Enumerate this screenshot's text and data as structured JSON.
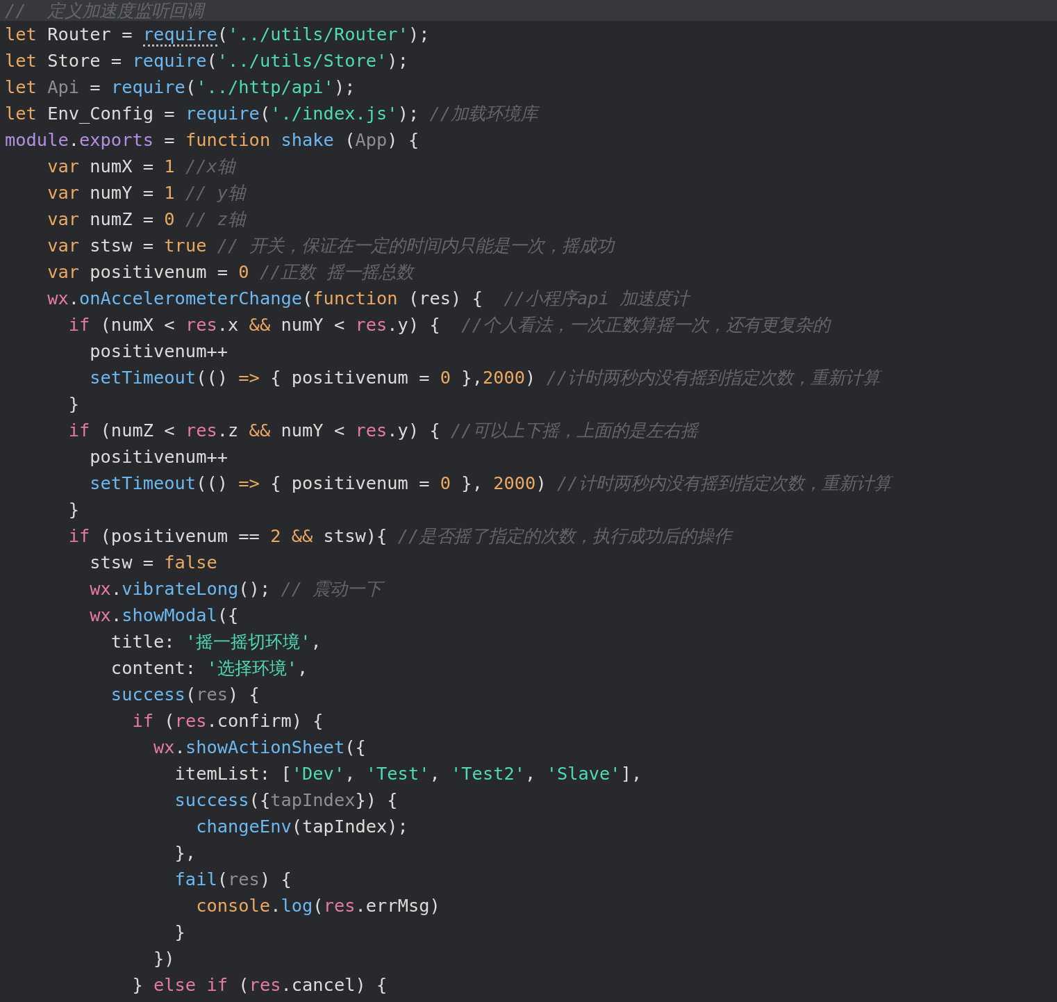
{
  "editor": {
    "lines": [
      {
        "highlighted": true,
        "tokens": [
          {
            "kind": "comment",
            "text": "//  定义加速度监听回调"
          }
        ]
      },
      {
        "tokens": [
          {
            "kind": "keyword",
            "text": "let"
          },
          {
            "kind": "plain",
            "text": " Router = "
          },
          {
            "kind": "function",
            "text": "require",
            "hint": true
          },
          {
            "kind": "plain",
            "text": "("
          },
          {
            "kind": "string",
            "text": "'../utils/Router'"
          },
          {
            "kind": "plain",
            "text": ");"
          }
        ]
      },
      {
        "tokens": [
          {
            "kind": "keyword",
            "text": "let"
          },
          {
            "kind": "plain",
            "text": " Store = "
          },
          {
            "kind": "function",
            "text": "require"
          },
          {
            "kind": "plain",
            "text": "("
          },
          {
            "kind": "string",
            "text": "'../utils/Store'"
          },
          {
            "kind": "plain",
            "text": ");"
          }
        ]
      },
      {
        "tokens": [
          {
            "kind": "keyword",
            "text": "let "
          },
          {
            "kind": "dim",
            "text": "Api"
          },
          {
            "kind": "plain",
            "text": " = "
          },
          {
            "kind": "function",
            "text": "require"
          },
          {
            "kind": "plain",
            "text": "("
          },
          {
            "kind": "string",
            "text": "'../http/api'"
          },
          {
            "kind": "plain",
            "text": ");"
          }
        ]
      },
      {
        "tokens": [
          {
            "kind": "keyword",
            "text": "let"
          },
          {
            "kind": "plain",
            "text": " Env_Config = "
          },
          {
            "kind": "function",
            "text": "require"
          },
          {
            "kind": "plain",
            "text": "("
          },
          {
            "kind": "string",
            "text": "'./index.js'"
          },
          {
            "kind": "plain",
            "text": "); "
          },
          {
            "kind": "comment",
            "text": "//加载环境库"
          }
        ]
      },
      {
        "tokens": [
          {
            "kind": "module",
            "text": "module"
          },
          {
            "kind": "plain",
            "text": "."
          },
          {
            "kind": "module",
            "text": "exports"
          },
          {
            "kind": "plain",
            "text": " = "
          },
          {
            "kind": "keyword",
            "text": "function "
          },
          {
            "kind": "function",
            "text": "shake"
          },
          {
            "kind": "plain",
            "text": " ("
          },
          {
            "kind": "dim",
            "text": "App"
          },
          {
            "kind": "plain",
            "text": ") {"
          }
        ]
      },
      {
        "tokens": [
          {
            "kind": "keyword",
            "text": "    var"
          },
          {
            "kind": "plain",
            "text": " numX = "
          },
          {
            "kind": "keyword",
            "text": "1 "
          },
          {
            "kind": "comment",
            "text": "//x轴"
          }
        ]
      },
      {
        "tokens": [
          {
            "kind": "keyword",
            "text": "    var"
          },
          {
            "kind": "plain",
            "text": " numY = "
          },
          {
            "kind": "keyword",
            "text": "1 "
          },
          {
            "kind": "comment",
            "text": "// y轴"
          }
        ]
      },
      {
        "tokens": [
          {
            "kind": "keyword",
            "text": "    var"
          },
          {
            "kind": "plain",
            "text": " numZ = "
          },
          {
            "kind": "keyword",
            "text": "0 "
          },
          {
            "kind": "comment",
            "text": "// z轴"
          }
        ]
      },
      {
        "tokens": [
          {
            "kind": "keyword",
            "text": "    var"
          },
          {
            "kind": "plain",
            "text": " stsw = "
          },
          {
            "kind": "keyword",
            "text": "true "
          },
          {
            "kind": "comment",
            "text": "// 开关，保证在一定的时间内只能是一次，摇成功"
          }
        ]
      },
      {
        "tokens": [
          {
            "kind": "keyword",
            "text": "    var"
          },
          {
            "kind": "plain",
            "text": " positivenum = "
          },
          {
            "kind": "keyword",
            "text": "0 "
          },
          {
            "kind": "comment",
            "text": "//正数 摇一摇总数"
          }
        ]
      },
      {
        "tokens": [
          {
            "kind": "control",
            "text": "    wx"
          },
          {
            "kind": "plain",
            "text": "."
          },
          {
            "kind": "function",
            "text": "onAccelerometerChange"
          },
          {
            "kind": "plain",
            "text": "("
          },
          {
            "kind": "keyword",
            "text": "function"
          },
          {
            "kind": "plain",
            "text": " (res) {  "
          },
          {
            "kind": "comment",
            "text": "//小程序api 加速度计"
          }
        ]
      },
      {
        "tokens": [
          {
            "kind": "control",
            "text": "      if"
          },
          {
            "kind": "plain",
            "text": " (numX < "
          },
          {
            "kind": "control",
            "text": "res"
          },
          {
            "kind": "plain",
            "text": ".x "
          },
          {
            "kind": "keyword",
            "text": "&&"
          },
          {
            "kind": "plain",
            "text": " numY < "
          },
          {
            "kind": "control",
            "text": "res"
          },
          {
            "kind": "plain",
            "text": ".y) {  "
          },
          {
            "kind": "comment",
            "text": "//个人看法，一次正数算摇一次，还有更复杂的"
          }
        ]
      },
      {
        "tokens": [
          {
            "kind": "plain",
            "text": "        positivenum++"
          }
        ]
      },
      {
        "tokens": [
          {
            "kind": "function",
            "text": "        setTimeout"
          },
          {
            "kind": "plain",
            "text": "(() "
          },
          {
            "kind": "keyword",
            "text": "=>"
          },
          {
            "kind": "plain",
            "text": " { positivenum = "
          },
          {
            "kind": "keyword",
            "text": "0"
          },
          {
            "kind": "plain",
            "text": " },"
          },
          {
            "kind": "keyword",
            "text": "2000"
          },
          {
            "kind": "plain",
            "text": ") "
          },
          {
            "kind": "comment",
            "text": "//计时两秒内没有摇到指定次数，重新计算"
          }
        ]
      },
      {
        "tokens": [
          {
            "kind": "plain",
            "text": "      }"
          }
        ]
      },
      {
        "tokens": [
          {
            "kind": "control",
            "text": "      if"
          },
          {
            "kind": "plain",
            "text": " (numZ < "
          },
          {
            "kind": "control",
            "text": "res"
          },
          {
            "kind": "plain",
            "text": ".z "
          },
          {
            "kind": "keyword",
            "text": "&&"
          },
          {
            "kind": "plain",
            "text": " numY < "
          },
          {
            "kind": "control",
            "text": "res"
          },
          {
            "kind": "plain",
            "text": ".y) { "
          },
          {
            "kind": "comment",
            "text": "//可以上下摇，上面的是左右摇"
          }
        ]
      },
      {
        "tokens": [
          {
            "kind": "plain",
            "text": "        positivenum++"
          }
        ]
      },
      {
        "tokens": [
          {
            "kind": "function",
            "text": "        setTimeout"
          },
          {
            "kind": "plain",
            "text": "(() "
          },
          {
            "kind": "keyword",
            "text": "=>"
          },
          {
            "kind": "plain",
            "text": " { positivenum = "
          },
          {
            "kind": "keyword",
            "text": "0"
          },
          {
            "kind": "plain",
            "text": " }, "
          },
          {
            "kind": "keyword",
            "text": "2000"
          },
          {
            "kind": "plain",
            "text": ") "
          },
          {
            "kind": "comment",
            "text": "//计时两秒内没有摇到指定次数，重新计算"
          }
        ]
      },
      {
        "tokens": [
          {
            "kind": "plain",
            "text": "      }"
          }
        ]
      },
      {
        "tokens": [
          {
            "kind": "control",
            "text": "      if"
          },
          {
            "kind": "plain",
            "text": " (positivenum == "
          },
          {
            "kind": "keyword",
            "text": "2 &&"
          },
          {
            "kind": "plain",
            "text": " stsw){ "
          },
          {
            "kind": "comment",
            "text": "//是否摇了指定的次数，执行成功后的操作"
          }
        ]
      },
      {
        "tokens": [
          {
            "kind": "plain",
            "text": "        stsw = "
          },
          {
            "kind": "keyword",
            "text": "false"
          }
        ]
      },
      {
        "tokens": [
          {
            "kind": "control",
            "text": "        wx"
          },
          {
            "kind": "plain",
            "text": "."
          },
          {
            "kind": "function",
            "text": "vibrateLong"
          },
          {
            "kind": "plain",
            "text": "(); "
          },
          {
            "kind": "comment",
            "text": "// 震动一下"
          }
        ]
      },
      {
        "tokens": [
          {
            "kind": "control",
            "text": "        wx"
          },
          {
            "kind": "plain",
            "text": "."
          },
          {
            "kind": "function",
            "text": "showModal"
          },
          {
            "kind": "plain",
            "text": "({"
          }
        ]
      },
      {
        "tokens": [
          {
            "kind": "plain",
            "text": "          title: "
          },
          {
            "kind": "string",
            "text": "'摇一摇切环境'"
          },
          {
            "kind": "plain",
            "text": ","
          }
        ]
      },
      {
        "tokens": [
          {
            "kind": "plain",
            "text": "          content: "
          },
          {
            "kind": "string",
            "text": "'选择环境'"
          },
          {
            "kind": "plain",
            "text": ","
          }
        ]
      },
      {
        "tokens": [
          {
            "kind": "function",
            "text": "          success"
          },
          {
            "kind": "plain",
            "text": "("
          },
          {
            "kind": "dim",
            "text": "res"
          },
          {
            "kind": "plain",
            "text": ") {"
          }
        ]
      },
      {
        "tokens": [
          {
            "kind": "control",
            "text": "            if"
          },
          {
            "kind": "plain",
            "text": " ("
          },
          {
            "kind": "control",
            "text": "res"
          },
          {
            "kind": "plain",
            "text": ".confirm) {"
          }
        ]
      },
      {
        "tokens": [
          {
            "kind": "control",
            "text": "              wx"
          },
          {
            "kind": "plain",
            "text": "."
          },
          {
            "kind": "function",
            "text": "showActionSheet"
          },
          {
            "kind": "plain",
            "text": "({"
          }
        ]
      },
      {
        "tokens": [
          {
            "kind": "plain",
            "text": "                itemList: ["
          },
          {
            "kind": "string",
            "text": "'Dev'"
          },
          {
            "kind": "plain",
            "text": ", "
          },
          {
            "kind": "string",
            "text": "'Test'"
          },
          {
            "kind": "plain",
            "text": ", "
          },
          {
            "kind": "string",
            "text": "'Test2'"
          },
          {
            "kind": "plain",
            "text": ", "
          },
          {
            "kind": "string",
            "text": "'Slave'"
          },
          {
            "kind": "plain",
            "text": "],"
          }
        ]
      },
      {
        "tokens": [
          {
            "kind": "function",
            "text": "                success"
          },
          {
            "kind": "plain",
            "text": "({"
          },
          {
            "kind": "dim",
            "text": "tapIndex"
          },
          {
            "kind": "plain",
            "text": "}) {"
          }
        ]
      },
      {
        "tokens": [
          {
            "kind": "function",
            "text": "                  changeEnv"
          },
          {
            "kind": "plain",
            "text": "(tapIndex);"
          }
        ]
      },
      {
        "tokens": [
          {
            "kind": "plain",
            "text": "                },"
          }
        ]
      },
      {
        "tokens": [
          {
            "kind": "function",
            "text": "                fail"
          },
          {
            "kind": "plain",
            "text": "("
          },
          {
            "kind": "dim",
            "text": "res"
          },
          {
            "kind": "plain",
            "text": ") {"
          }
        ]
      },
      {
        "tokens": [
          {
            "kind": "keyword",
            "text": "                  console"
          },
          {
            "kind": "plain",
            "text": "."
          },
          {
            "kind": "function",
            "text": "log"
          },
          {
            "kind": "plain",
            "text": "("
          },
          {
            "kind": "control",
            "text": "res"
          },
          {
            "kind": "plain",
            "text": ".errMsg)"
          }
        ]
      },
      {
        "tokens": [
          {
            "kind": "plain",
            "text": "                }"
          }
        ]
      },
      {
        "tokens": [
          {
            "kind": "plain",
            "text": "              })"
          }
        ]
      },
      {
        "tokens": [
          {
            "kind": "plain",
            "text": "            } "
          },
          {
            "kind": "control",
            "text": "else if"
          },
          {
            "kind": "plain",
            "text": " ("
          },
          {
            "kind": "control",
            "text": "res"
          },
          {
            "kind": "plain",
            "text": ".cancel) {"
          }
        ]
      }
    ]
  }
}
